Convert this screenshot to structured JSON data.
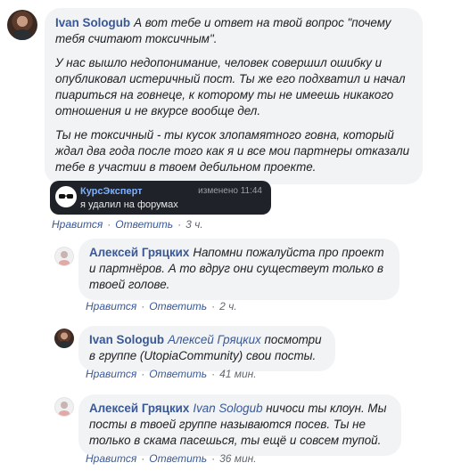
{
  "comments": [
    {
      "author": "Ivan Sologub",
      "paragraphs": [
        "А вот тебе и ответ на твой вопрос \"почему тебя считают токсичным\".",
        "У нас вышло недопонимание, человек совершил ошибку и опубликовал истеричный пост. Ты же его подхватил и начал пиариться на говнеце, к которому ты не имеешь никакого отношения и не вкурсе вообще дел.",
        "Ты не токсичный - ты кусок злопамятного говна, который ждал два года после того как я и все мои партнеры отказали тебе в участии в твоем дебильном проекте."
      ],
      "like": "Нравится",
      "reply": "Ответить",
      "time": "3 ч."
    },
    {
      "author": "Алексей Гряцких",
      "text": "Напомни пожалуйста про проект и партнёров. А то вдруг они существеут только в твоей голове.",
      "like": "Нравится",
      "reply": "Ответить",
      "time": "2 ч."
    },
    {
      "author": "Ivan Sologub",
      "mention": "Алексей Гряцких",
      "text": "посмотри в группе (UtopiaCommunity) свои посты.",
      "like": "Нравится",
      "reply": "Ответить",
      "time": "41 мин."
    },
    {
      "author": "Алексей Гряцких",
      "mention": "Ivan Sologub",
      "text": "ничоси ты клоун. Мы посты в твоей группе называются посев. Ты не только в скама пасешься, ты ещё и совсем тупой.",
      "like": "Нравится",
      "reply": "Ответить",
      "time": "36 мин."
    }
  ],
  "embed": {
    "name": "КурсЭксперт",
    "message": "я удалил на форумах",
    "edited": "изменено  11:44"
  },
  "separator": "·"
}
